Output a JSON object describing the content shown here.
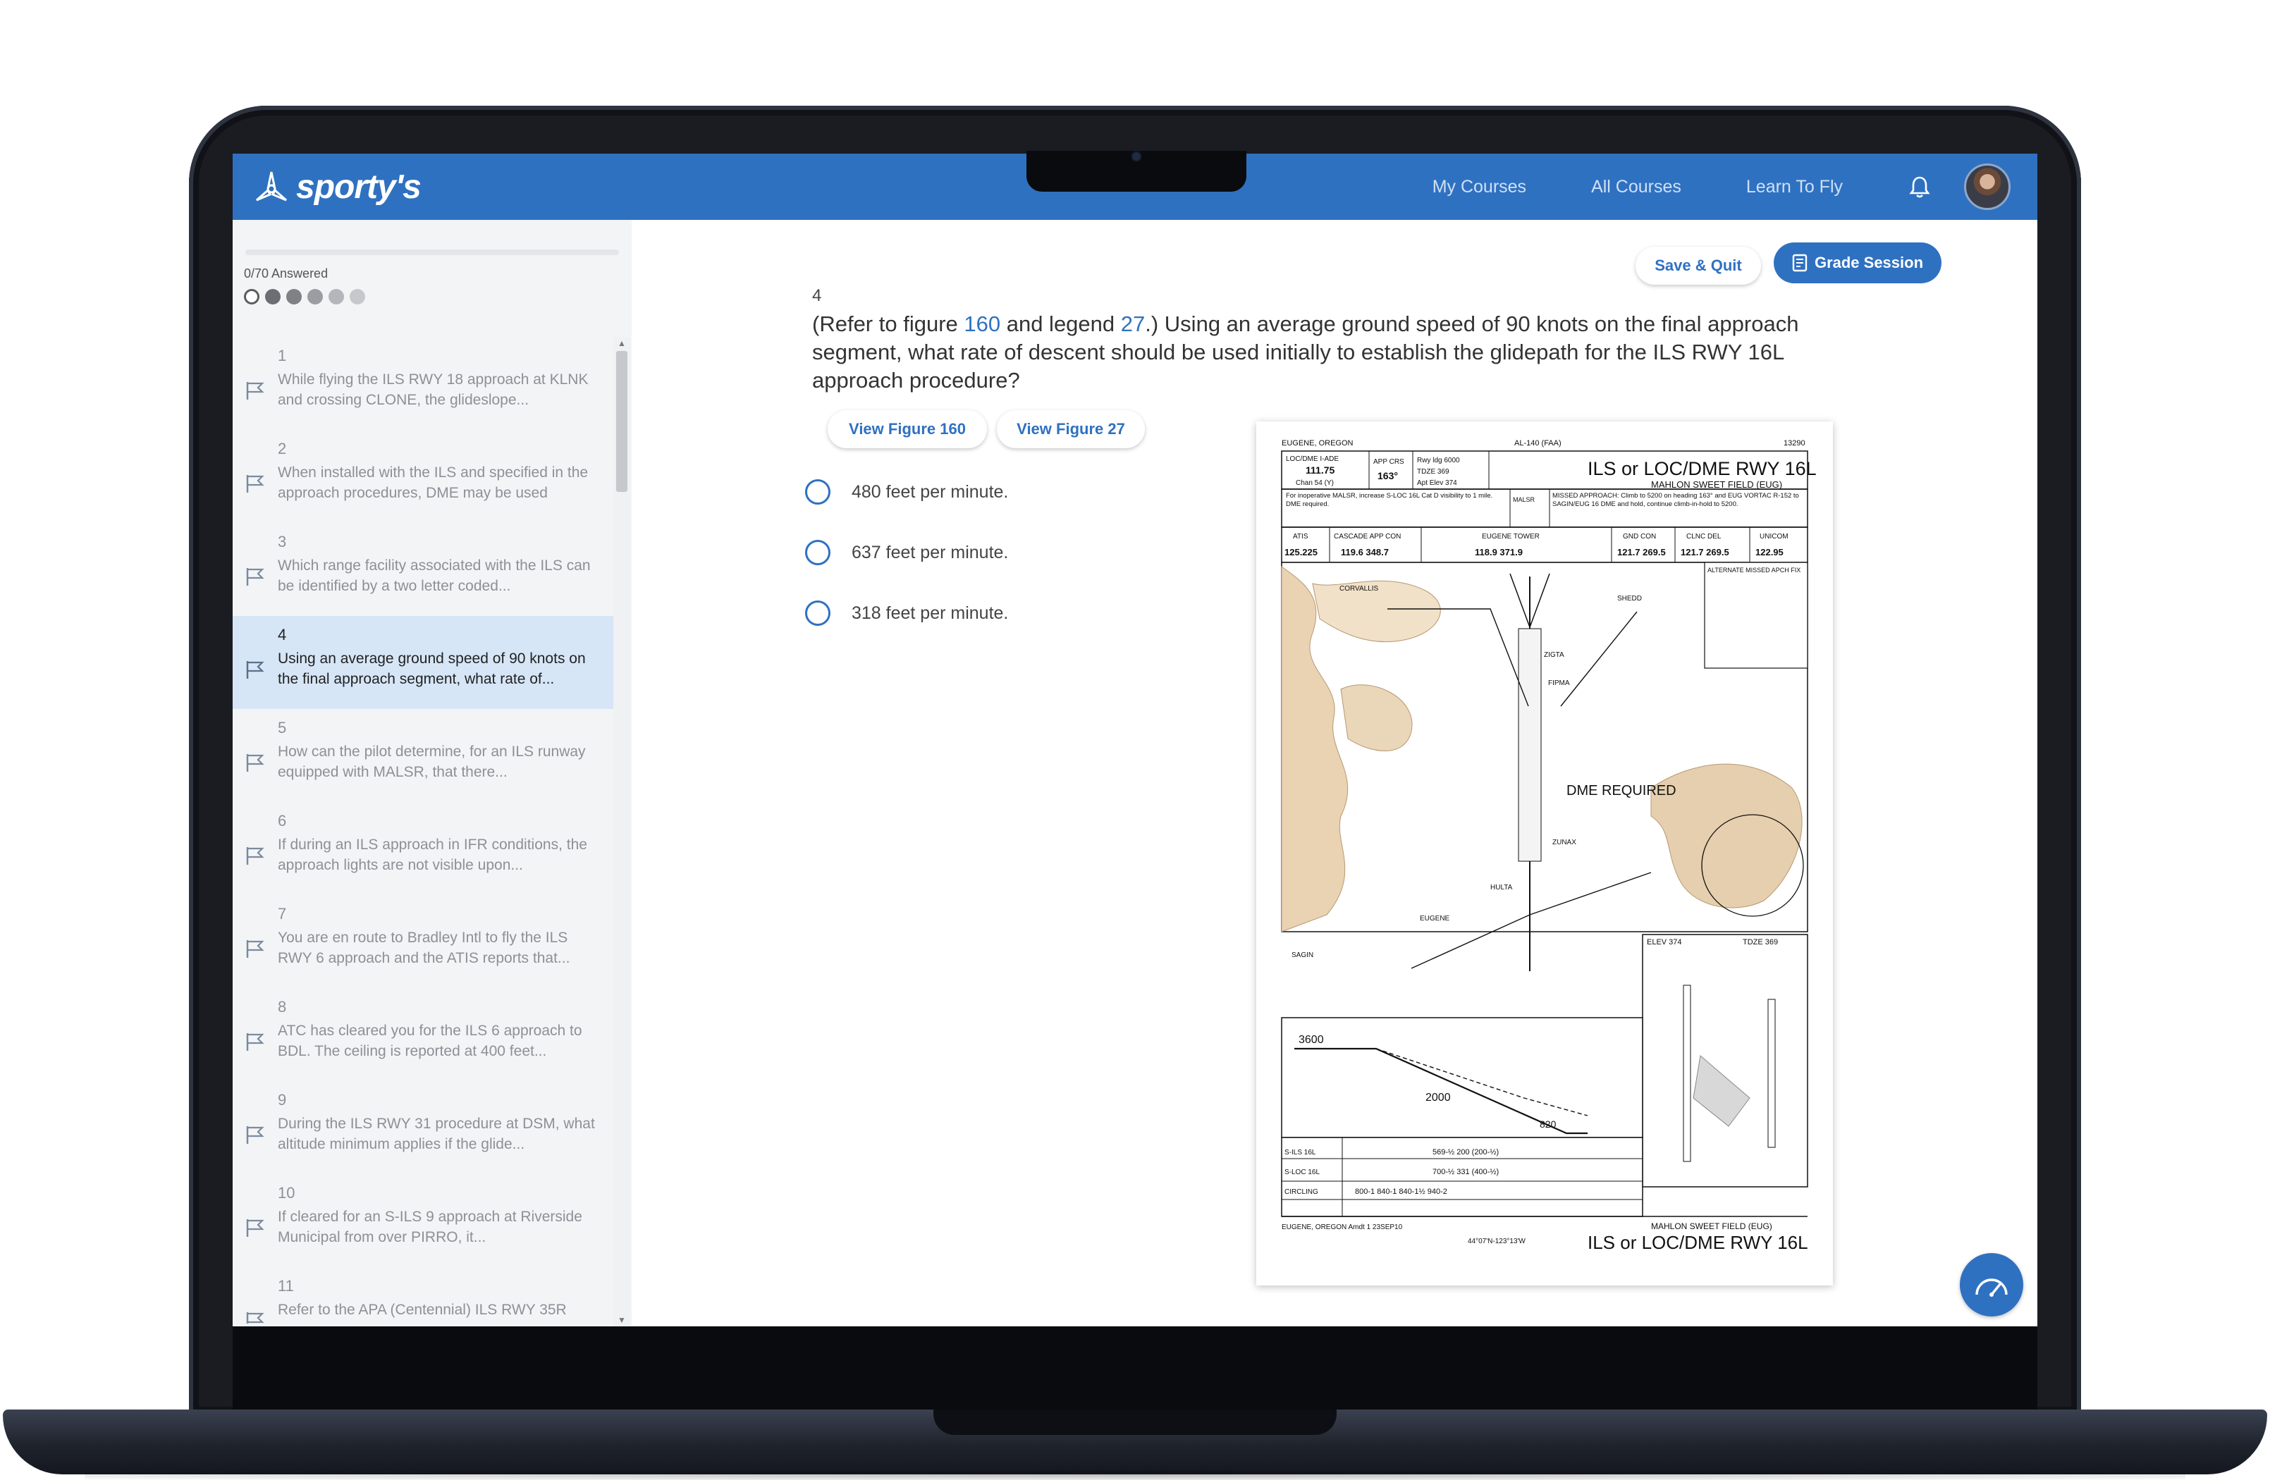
{
  "app": {
    "logo_text": "sporty's",
    "nav": [
      "My Courses",
      "All Courses",
      "Learn To Fly"
    ]
  },
  "sidebar": {
    "answered": "0/70 Answered",
    "questions": [
      {
        "num": "1",
        "text": "While flying the ILS RWY 18 approach at KLNK and crossing CLONE, the glideslope..."
      },
      {
        "num": "2",
        "text": "When installed with the ILS and specified in the approach procedures, DME may be used"
      },
      {
        "num": "3",
        "text": "Which range facility associated with the ILS can be identified by a two letter coded..."
      },
      {
        "num": "4",
        "text": "Using an average ground speed of 90 knots on the final approach segment, what rate of..."
      },
      {
        "num": "5",
        "text": "How can the pilot determine, for an ILS runway equipped with MALSR, that there..."
      },
      {
        "num": "6",
        "text": "If during an ILS approach in IFR conditions, the approach lights are not visible upon..."
      },
      {
        "num": "7",
        "text": "You are en route to Bradley Intl to fly the ILS RWY 6 approach and the ATIS reports that..."
      },
      {
        "num": "8",
        "text": "ATC has cleared you for the ILS 6 approach to BDL. The ceiling is reported at 400 feet..."
      },
      {
        "num": "9",
        "text": "During the ILS RWY 31 procedure at DSM, what altitude minimum applies if the glide..."
      },
      {
        "num": "10",
        "text": "If cleared for an S-ILS 9 approach at Riverside Municipal from over PIRRO, it..."
      },
      {
        "num": "11",
        "text": "Refer to the APA (Centennial) ILS RWY 35R"
      }
    ]
  },
  "toolbar": {
    "save_label": "Save & Quit",
    "grade_label": "Grade Session"
  },
  "question": {
    "number": "4",
    "stem_1": "(Refer to figure ",
    "fig_a": "160",
    "stem_2": " and legend ",
    "fig_b": "27",
    "stem_3": ".) Using an average ground speed of 90 knots on the final approach segment, what rate of descent should be used initially to establish the glidepath for the ILS RWY 16L approach procedure?",
    "view_fig_a": "View Figure 160",
    "view_fig_b": "View Figure 27",
    "options": [
      "480 feet per minute.",
      "637 feet per minute.",
      "318 feet per minute."
    ]
  },
  "figure": {
    "city": "EUGENE, OREGON",
    "chart_id": "AL-140 (FAA)",
    "amdt_num": "13290",
    "title": "ILS or LOC/DME RWY 16L",
    "airport": "MAHLON SWEET FIELD (EUG)",
    "loc_box": "LOC/DME I-ADE",
    "loc_freq": "111.75",
    "loc_chan": "Chan 54 (Y)",
    "app_crs_label": "APP CRS",
    "app_crs": "163°",
    "rwy_ldg": "Rwy ldg 6000",
    "tdze": "TDZE 369",
    "apt_elev": "Apt Elev 374",
    "note_malsr": "For inoperative MALSR, increase S-LOC 16L Cat D visibility to 1 mile. DME required.",
    "malsr": "MALSR",
    "missed": "MISSED APPROACH: Climb to 5200 on heading 163° and EUG VORTAC R-152 to SAGIN/EUG 16 DME and hold, continue climb-in-hold to 5200.",
    "comm_labels": [
      "ATIS",
      "CASCADE APP CON",
      "EUGENE TOWER",
      "GND CON",
      "CLNC DEL",
      "UNICOM"
    ],
    "comm_freqs": [
      "125.225",
      "119.6 348.7",
      "118.9 371.9",
      "121.7 269.5",
      "121.7 269.5",
      "122.95"
    ],
    "dme_required": "DME REQUIRED",
    "fixes": [
      "CORVALLIS",
      "SHEDD",
      "ZIGTA",
      "FIPMA",
      "ZUNAX",
      "HULTA",
      "EUGENE",
      "SAGIN"
    ],
    "alt_missed": "ALTERNATE MISSED APCH FIX",
    "elev": "ELEV 374",
    "tdze_box": "TDZE 369",
    "profile_alts": [
      "3600",
      "2000",
      "820"
    ],
    "minimums": [
      {
        "cat": "S-ILS 16L",
        "val": "569-½ 200 (200-½)"
      },
      {
        "cat": "S-LOC 16L",
        "val": "700-½ 331 (400-½)"
      },
      {
        "cat": "CIRCLING",
        "val": "800-1 840-1 840-1½ 940-2"
      }
    ],
    "footer_left": "EUGENE, OREGON Amdt 1 23SEP10",
    "footer_coord": "44°07'N-123°13'W",
    "footer_airport": "MAHLON SWEET FIELD (EUG)",
    "footer_title": "ILS or LOC/DME RWY 16L"
  }
}
